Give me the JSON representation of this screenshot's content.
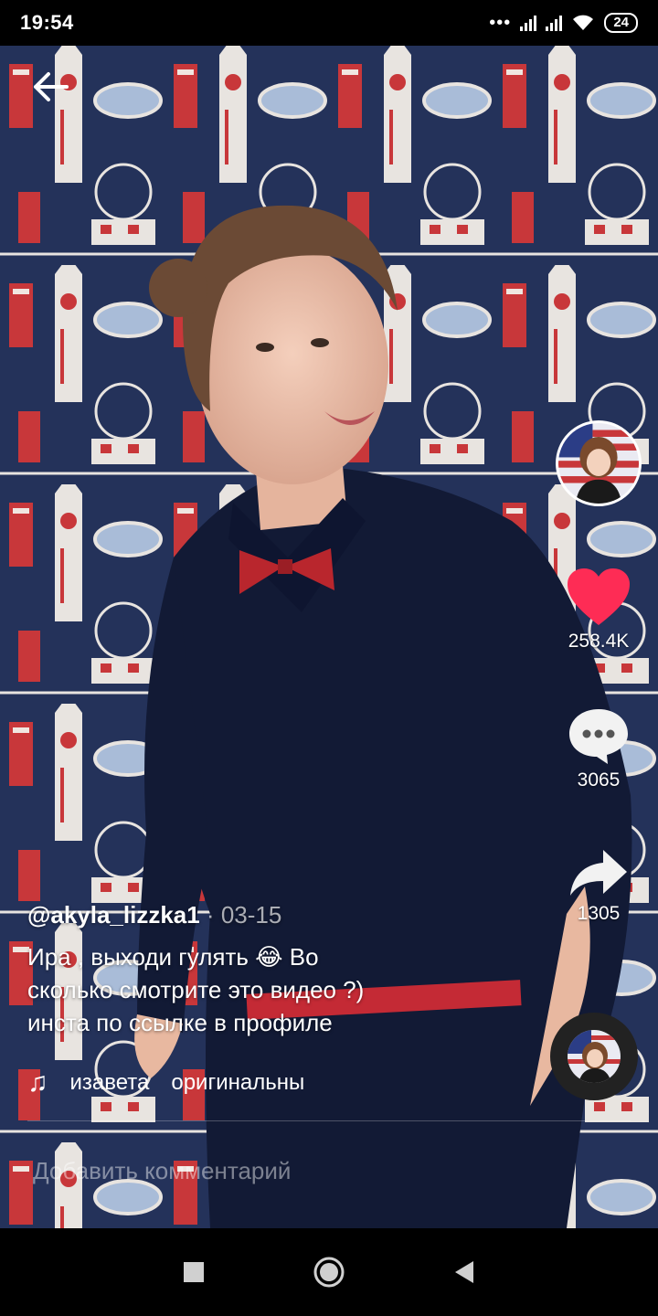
{
  "status_bar": {
    "time": "19:54",
    "dots": "•••",
    "battery": "24"
  },
  "video": {
    "like_count": "258.4K",
    "comment_count": "3065",
    "share_count": "1305"
  },
  "caption": {
    "author": "@akyla_lizzka1",
    "separator": " · ",
    "date": "03-15",
    "description_line1": "Ира , выходи гулять 😂 Во",
    "description_line2": "сколько смотрите это видео ?)",
    "description_line3": "инста по ссылке в профиле"
  },
  "music": {
    "note_icon": "♫",
    "text1": "изавета",
    "text2": "оригинальны"
  },
  "comment_box": {
    "placeholder": "Добавить комментарий"
  },
  "colors": {
    "like": "#fe2c55",
    "wallpaper": "#24325a"
  },
  "icons": [
    "back-arrow-icon",
    "heart-icon",
    "comment-bubble-icon",
    "share-arrow-icon",
    "music-note-icon",
    "nav-square-icon",
    "nav-circle-icon",
    "nav-triangle-icon"
  ]
}
